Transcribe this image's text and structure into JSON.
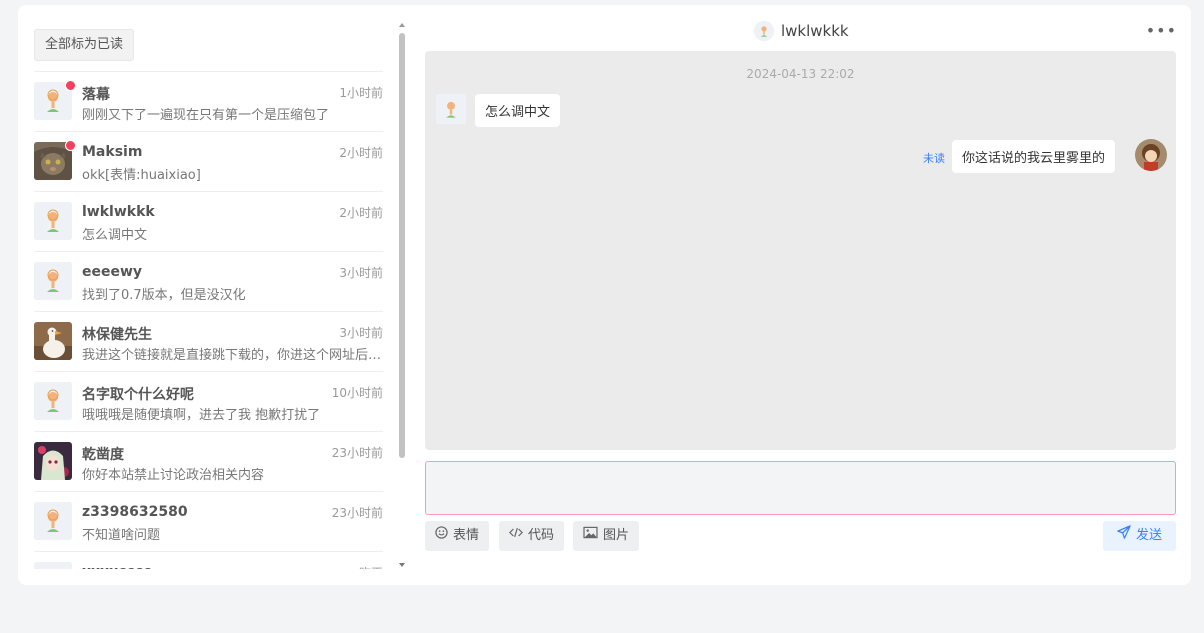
{
  "sidebar": {
    "mark_all_label": "全部标为已读",
    "conversations": [
      {
        "name": "落幕",
        "time": "1小时前",
        "message": "刚刚又下了一遍现在只有第一个是压缩包了",
        "unread": true,
        "avatar": "default"
      },
      {
        "name": "Maksim",
        "time": "2小时前",
        "message": "okk[表情:huaixiao]",
        "unread": true,
        "avatar": "cat"
      },
      {
        "name": "lwklwkkk",
        "time": "2小时前",
        "message": "怎么调中文",
        "unread": false,
        "avatar": "default"
      },
      {
        "name": "eeeewy",
        "time": "3小时前",
        "message": "找到了0.7版本，但是没汉化",
        "unread": false,
        "avatar": "default"
      },
      {
        "name": "林保健先生",
        "time": "3小时前",
        "message": "我进这个链接就是直接跳下载的，你进这个网址后稍...",
        "unread": false,
        "avatar": "goose"
      },
      {
        "name": "名字取个什么好呢",
        "time": "10小时前",
        "message": "哦哦哦是随便填啊，进去了我 抱歉打扰了",
        "unread": false,
        "avatar": "default"
      },
      {
        "name": "乾凿度",
        "time": "23小时前",
        "message": "你好本站禁止讨论政治相关内容",
        "unread": false,
        "avatar": "anime"
      },
      {
        "name": "z3398632580",
        "time": "23小时前",
        "message": "不知道啥问题",
        "unread": false,
        "avatar": "default"
      },
      {
        "name": "xxxxcccc",
        "time": "昨天",
        "message": "",
        "unread": false,
        "avatar": "default"
      }
    ]
  },
  "chat": {
    "title": "lwklwkkk",
    "more_label": "•••",
    "date": "2024-04-13 22:02",
    "received_message": "怎么调中文",
    "sent_message": "你这话说的我云里雾里的",
    "unread_label": "未读"
  },
  "composer": {
    "emoji_label": "表情",
    "code_label": "代码",
    "image_label": "图片",
    "send_label": "发送"
  },
  "colors": {
    "accent": "#3b82f6",
    "unread_dot": "#f43f5e",
    "input_border": "#f49ac1"
  }
}
